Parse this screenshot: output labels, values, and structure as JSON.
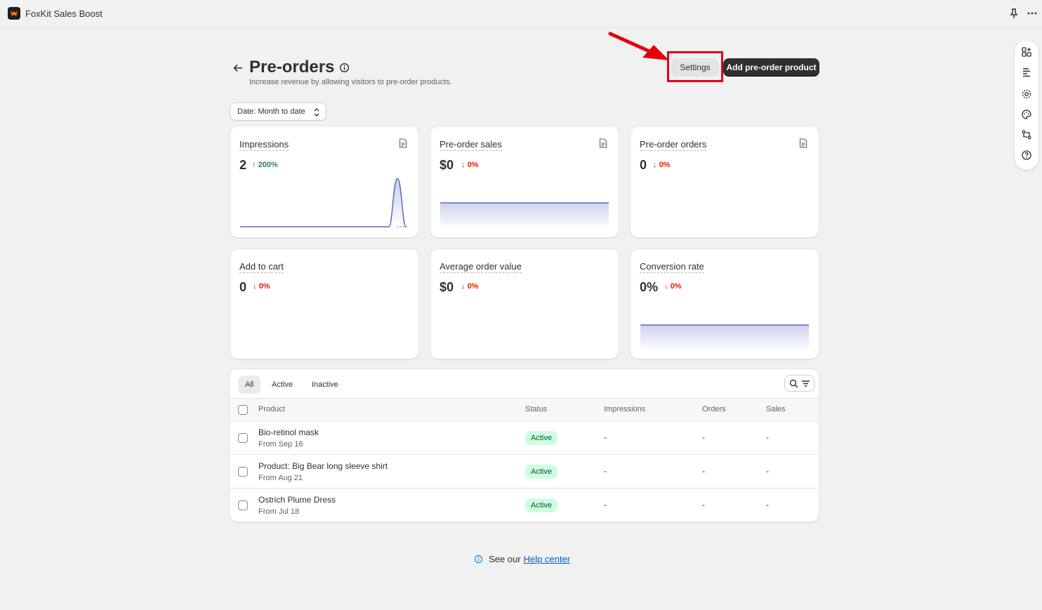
{
  "app": {
    "name": "FoxKit Sales Boost"
  },
  "header": {
    "title": "Pre-orders",
    "subtitle": "Increase revenue by allowing visitors to pre-order products.",
    "settings_label": "Settings",
    "add_label": "Add pre-order product"
  },
  "date_filter": {
    "label": "Date: Month to date"
  },
  "metrics": [
    {
      "title": "Impressions",
      "value": "2",
      "change": "200%",
      "direction": "up"
    },
    {
      "title": "Pre-order sales",
      "value": "$0",
      "change": "0%",
      "direction": "down"
    },
    {
      "title": "Pre-order orders",
      "value": "0",
      "change": "0%",
      "direction": "down"
    },
    {
      "title": "Add to cart",
      "value": "0",
      "change": "0%",
      "direction": "down"
    },
    {
      "title": "Average order value",
      "value": "$0",
      "change": "0%",
      "direction": "down"
    },
    {
      "title": "Conversion rate",
      "value": "0%",
      "change": "0%",
      "direction": "down"
    }
  ],
  "tabs": [
    "All",
    "Active",
    "Inactive"
  ],
  "table": {
    "columns": [
      "Product",
      "Status",
      "Impressions",
      "Orders",
      "Sales"
    ],
    "rows": [
      {
        "name": "Bio-retinol mask",
        "date": "From Sep 16",
        "status": "Active",
        "impressions": "-",
        "orders": "-",
        "sales": "-"
      },
      {
        "name": "Product: Big Bear long sleeve shirt",
        "date": "From Aug 21",
        "status": "Active",
        "impressions": "-",
        "orders": "-",
        "sales": "-"
      },
      {
        "name": "Ostrich Plume Dress",
        "date": "From Jul 18",
        "status": "Active",
        "impressions": "-",
        "orders": "-",
        "sales": "-"
      }
    ]
  },
  "footer": {
    "prefix": "See our",
    "link": "Help center"
  },
  "colors": {
    "accent_up": "#29845a",
    "accent_down": "#e51c00",
    "chart_line": "#5c6ac4",
    "annotation": "#e3000f"
  }
}
